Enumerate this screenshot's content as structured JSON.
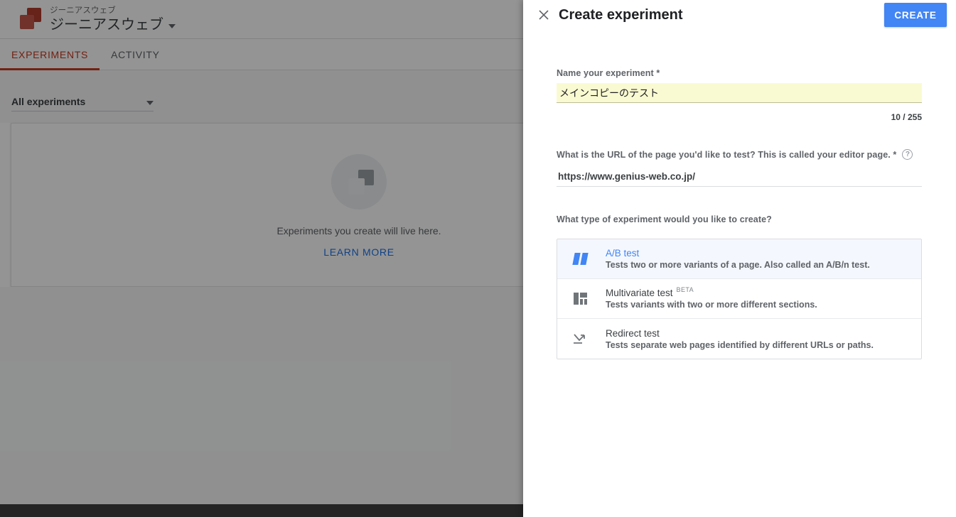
{
  "background": {
    "logo_icon": "optimize-logo-icon",
    "account_name": "ジーニアスウェブ",
    "container_name": "ジーニアスウェブ",
    "container_caret_icon": "chevron-down-icon",
    "tabs": [
      {
        "label": "EXPERIMENTS",
        "active": true
      },
      {
        "label": "ACTIVITY",
        "active": false
      }
    ],
    "filter": {
      "label": "All experiments",
      "caret_icon": "chevron-down-icon"
    },
    "empty_state": {
      "illustration_icon": "experiments-placeholder-icon",
      "message": "Experiments you create will live here.",
      "link_label": "LEARN MORE"
    }
  },
  "dialog": {
    "close_icon": "close-icon",
    "title": "Create experiment",
    "create_label": "CREATE",
    "name_field": {
      "label": "Name your experiment *",
      "value": "メインコピーのテスト",
      "placeholder": "",
      "counter": "10 / 255"
    },
    "url_field": {
      "label": "What is the URL of the page you'd like to test? This is called your editor page. *",
      "help_icon": "help-circle-icon",
      "help_glyph": "?",
      "value": "https://www.genius-web.co.jp/",
      "placeholder": ""
    },
    "type_section": {
      "label": "What type of experiment would you like to create?",
      "options": [
        {
          "icon": "ab-test-icon",
          "title": "A/B test",
          "badge": "",
          "description": "Tests two or more variants of a page. Also called an A/B/n test.",
          "selected": true
        },
        {
          "icon": "multivariate-test-icon",
          "title": "Multivariate test",
          "badge": "BETA",
          "description": "Tests variants with two or more different sections.",
          "selected": false
        },
        {
          "icon": "redirect-test-icon",
          "title": "Redirect test",
          "badge": "",
          "description": "Tests separate web pages identified by different URLs or paths.",
          "selected": false
        }
      ]
    }
  },
  "colors": {
    "accent_blue": "#4285f4",
    "link_blue": "#1a73e8",
    "tab_active_red": "#c5391f",
    "autofill_yellow": "#fafad2",
    "selected_row": "#f4f8fe"
  }
}
